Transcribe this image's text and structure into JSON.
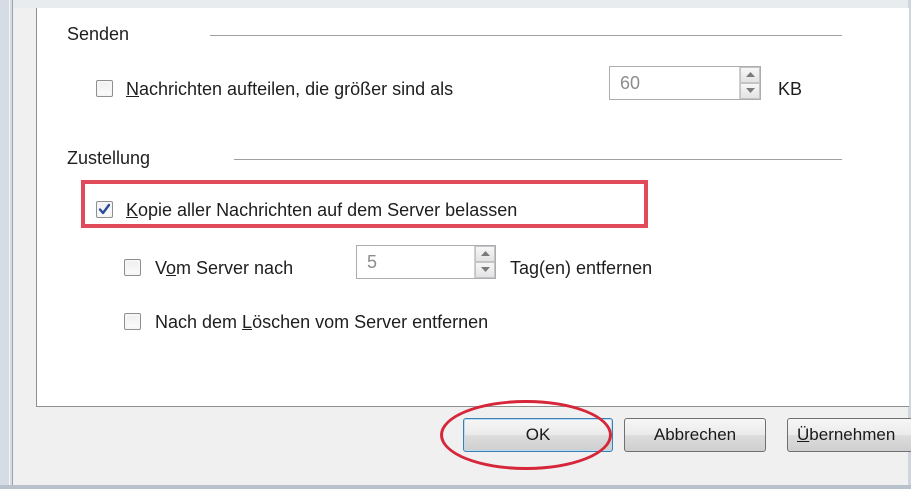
{
  "send": {
    "group_label": "Senden",
    "split": {
      "checked": false,
      "label_mnemonic": "N",
      "label_rest": "achrichten aufteilen, die größer sind als",
      "value": "60",
      "unit": "KB"
    }
  },
  "delivery": {
    "group_label": "Zustellung",
    "keep_copy": {
      "checked": true,
      "label_mnemonic": "K",
      "label_rest": "opie aller Nachrichten auf dem Server belassen"
    },
    "remove_after": {
      "checked": false,
      "label_pre": "V",
      "label_mnemonic": "o",
      "label_rest": "m Server nach",
      "value": "5",
      "unit": "Tag(en) entfernen"
    },
    "remove_on_delete": {
      "checked": false,
      "label_pre": "Nach dem ",
      "label_mnemonic": "L",
      "label_rest": "öschen vom Server entfernen"
    }
  },
  "buttons": {
    "ok": "OK",
    "cancel": "Abbrechen",
    "apply_mnemonic": "Ü",
    "apply_pre": "",
    "apply_rest": "bernehmen"
  },
  "colors": {
    "highlight": "#e04a5a",
    "circle": "#d6263a",
    "checkmark": "#2a4d9b"
  }
}
